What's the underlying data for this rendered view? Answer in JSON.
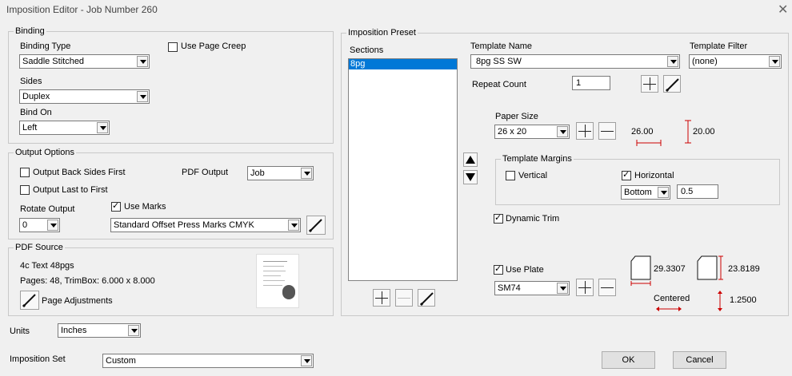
{
  "window": {
    "title": "Imposition Editor - Job Number 260",
    "close": "✕"
  },
  "binding": {
    "legend": "Binding",
    "binding_type_label": "Binding Type",
    "binding_type_value": "Saddle Stitched",
    "use_page_creep_label": "Use Page Creep",
    "use_page_creep_checked": false,
    "sides_label": "Sides",
    "sides_value": "Duplex",
    "bind_on_label": "Bind On",
    "bind_on_value": "Left"
  },
  "output_options": {
    "legend": "Output Options",
    "output_back_sides_first_label": "Output Back Sides First",
    "output_last_to_first_label": "Output Last to First",
    "pdf_output_label": "PDF Output",
    "pdf_output_value": "Job",
    "rotate_output_label": "Rotate Output",
    "rotate_output_value": "0",
    "use_marks_label": "Use Marks",
    "use_marks_checked": true,
    "marks_value": "Standard Offset Press Marks CMYK"
  },
  "pdf_source": {
    "legend": "PDF Source",
    "name": "4c Text 48pgs",
    "pages_info": "Pages: 48, TrimBox:  6.000 x 8.000",
    "page_adjustments_label": "Page Adjustments"
  },
  "units": {
    "label": "Units",
    "value": "Inches"
  },
  "imposition_set": {
    "label": "Imposition Set",
    "value": "Custom"
  },
  "preset": {
    "legend": "Imposition Preset",
    "sections_label": "Sections",
    "sections": [
      "8pg"
    ],
    "template_name_label": "Template Name",
    "template_name_value": "8pg SS SW",
    "template_filter_label": "Template Filter",
    "template_filter_value": "(none)",
    "repeat_count_label": "Repeat Count",
    "repeat_count_value": "1",
    "paper_size_label": "Paper Size",
    "paper_size_value": "26 x 20",
    "paper_width": "26.00",
    "paper_height": "20.00",
    "template_margins_legend": "Template Margins",
    "vertical_label": "Vertical",
    "horizontal_label": "Horizontal",
    "horizontal_checked": true,
    "margin_side_value": "Bottom",
    "margin_value": "0.5",
    "dynamic_trim_label": "Dynamic Trim",
    "dynamic_trim_checked": true,
    "use_plate_label": "Use Plate",
    "use_plate_checked": true,
    "plate_value": "SM74",
    "plate_width": "29.3307",
    "plate_height": "23.8189",
    "centered_label": "Centered",
    "offset_value": "1.2500"
  },
  "buttons": {
    "ok": "OK",
    "cancel": "Cancel"
  }
}
